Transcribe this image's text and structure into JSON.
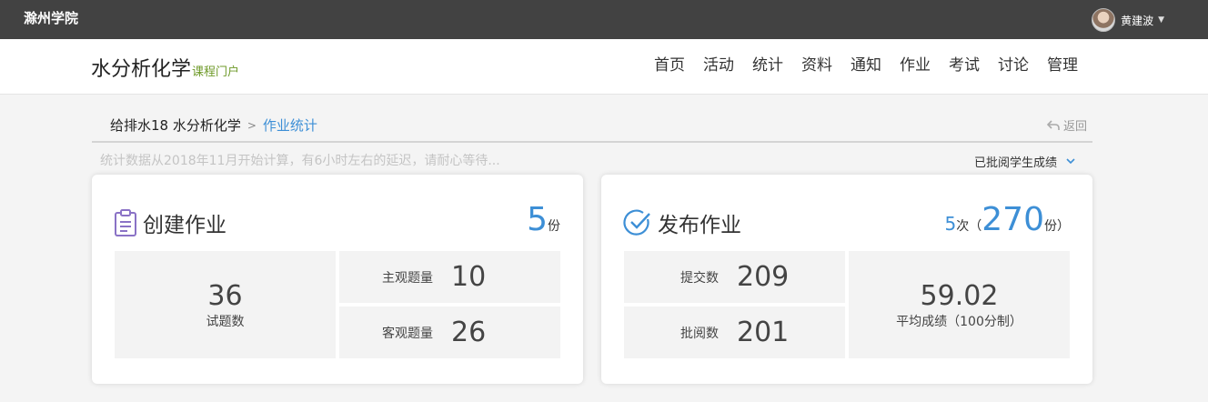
{
  "topbar": {
    "school": "滁州学院",
    "user_name": "黄建波"
  },
  "header": {
    "course_name": "水分析化学",
    "course_suffix": "课程门户",
    "nav": [
      "首页",
      "活动",
      "统计",
      "资料",
      "通知",
      "作业",
      "考试",
      "讨论",
      "管理"
    ]
  },
  "breadcrumb": {
    "course": "给排水18 水分析化学",
    "separator": ">",
    "current": "作业统计"
  },
  "back_label": "返回",
  "note": "统计数据从2018年11月开始计算，有6小时左右的延迟，请耐心等待...",
  "filter": {
    "selected": "已批阅学生成绩"
  },
  "create_card": {
    "title": "创建作业",
    "count": "5",
    "count_unit": "份",
    "question_total": "36",
    "question_total_label": "试题数",
    "subjective_label": "主观题量",
    "subjective_value": "10",
    "objective_label": "客观题量",
    "objective_value": "26"
  },
  "publish_card": {
    "title": "发布作业",
    "times": "5",
    "times_unit": "次（",
    "copies": "270",
    "copies_unit": "份）",
    "submit_label": "提交数",
    "submit_value": "209",
    "review_label": "批阅数",
    "review_value": "201",
    "avg_value": "59.02",
    "avg_label": "平均成绩（100分制）"
  },
  "colors": {
    "accent": "#3d8fd6",
    "topbar": "#424242",
    "portal": "#6f9a2a"
  }
}
